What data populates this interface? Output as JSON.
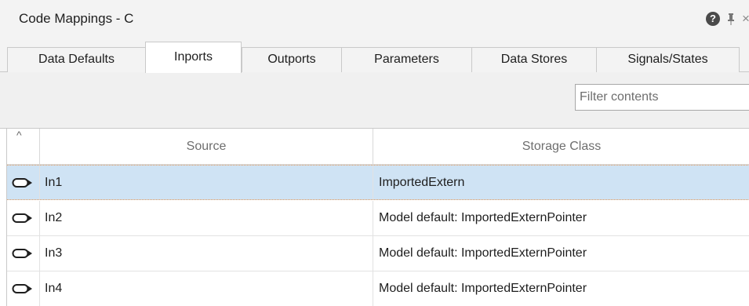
{
  "window": {
    "title": "Code Mappings - C",
    "help_label": "?",
    "close_label": "×"
  },
  "tabs": [
    {
      "label": "Data Defaults",
      "active": false
    },
    {
      "label": "Inports",
      "active": true
    },
    {
      "label": "Outports",
      "active": false
    },
    {
      "label": "Parameters",
      "active": false
    },
    {
      "label": "Data Stores",
      "active": false
    },
    {
      "label": "Signals/States",
      "active": false
    }
  ],
  "toolbar": {
    "filter_placeholder": "Filter contents"
  },
  "grid": {
    "sort_indicator": "^",
    "columns": {
      "source": "Source",
      "storage_class": "Storage Class"
    },
    "rows": [
      {
        "source": "In1",
        "storage_class": "ImportedExtern",
        "selected": true,
        "icon": "inport-icon"
      },
      {
        "source": "In2",
        "storage_class": "Model default: ImportedExternPointer",
        "selected": false,
        "icon": "inport-icon"
      },
      {
        "source": "In3",
        "storage_class": "Model default: ImportedExternPointer",
        "selected": false,
        "icon": "inport-icon"
      },
      {
        "source": "In4",
        "storage_class": "Model default: ImportedExternPointer",
        "selected": false,
        "icon": "inport-icon"
      }
    ]
  },
  "colors": {
    "selection": "#cfe3f4",
    "selection_border": "#e59a5a",
    "header_text": "#6e6e6e"
  }
}
